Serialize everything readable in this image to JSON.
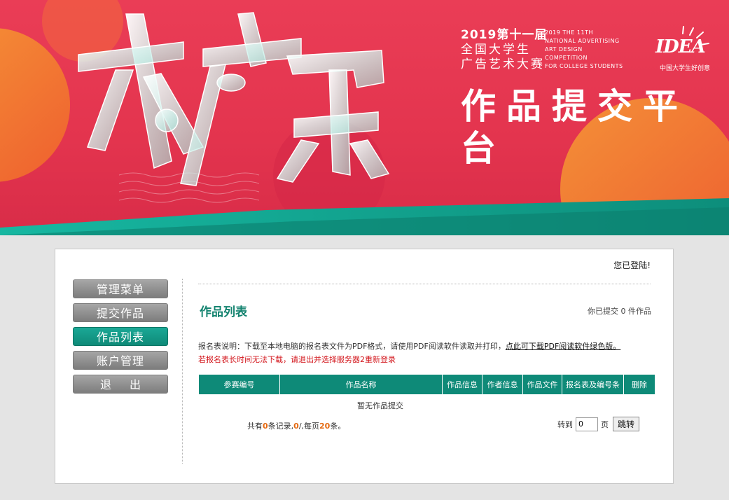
{
  "banner": {
    "year_title": "2019第十一届",
    "line2": "全国大学生",
    "line3": "广告艺术大赛",
    "en_lines": [
      "2019  THE 11TH",
      "NATIONAL ADVERTISING",
      "ART DESIGN",
      "COMPETITION",
      "FOR COLLEGE STUDENTS"
    ],
    "platform_title": "作品提交平台",
    "logo_word": "IDEA",
    "logo_sub": "中国大学生好创意",
    "colors": {
      "primary": "#e63a53",
      "teal": "#0e8a78"
    }
  },
  "header": {
    "login_status": "您已登陆!"
  },
  "sidebar": {
    "items": [
      {
        "label": "管理菜单",
        "active": false
      },
      {
        "label": "提交作品",
        "active": false
      },
      {
        "label": "作品列表",
        "active": true
      },
      {
        "label": "账户管理",
        "active": false
      },
      {
        "label": "退出",
        "active": false
      }
    ]
  },
  "main": {
    "title": "作品列表",
    "submitted_text": "你已提交 0 件作品",
    "note1_prefix": "报名表说明：下载至本地电脑的报名表文件为PDF格式，请使用PDF阅读软件读取并打印，",
    "note1_link": "点此可下载PDF阅读软件绿色版。",
    "note2": "若报名表长时间无法下载，请退出并选择服务器2重新登录",
    "table": {
      "columns": [
        "参赛编号",
        "作品名称",
        "作品信息",
        "作者信息",
        "作品文件",
        "报名表及编号条",
        "删除"
      ],
      "rows": [],
      "empty_text": "暂无作品提交"
    },
    "pager": {
      "prefix": "共有",
      "total": "0",
      "records_label": "条记录,",
      "current": "0",
      "slash": "/,每页",
      "per_page": "20",
      "suffix": "条。",
      "goto_label": "转到",
      "page_value": "0",
      "page_unit": "页",
      "jump_label": "跳转"
    }
  }
}
